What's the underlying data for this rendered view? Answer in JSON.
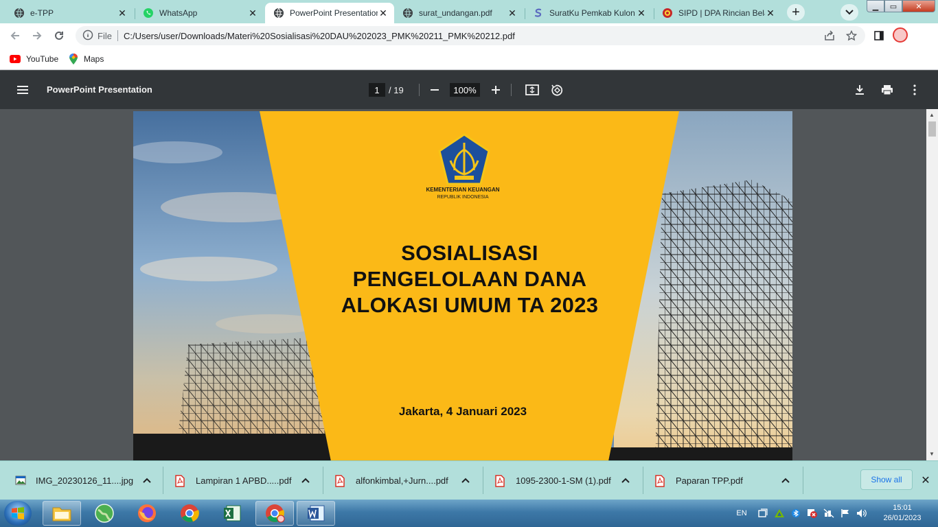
{
  "browser": {
    "tabs": [
      {
        "title": "e-TPP",
        "icon": "globe-icon",
        "active": false
      },
      {
        "title": "WhatsApp",
        "icon": "whatsapp-icon",
        "active": false
      },
      {
        "title": "PowerPoint Presentation",
        "icon": "globe-icon",
        "active": true
      },
      {
        "title": "surat_undangan.pdf",
        "icon": "globe-icon",
        "active": false
      },
      {
        "title": "SuratKu Pemkab Kulon",
        "icon": "suratku-icon",
        "active": false
      },
      {
        "title": "SIPD | DPA Rincian Bela",
        "icon": "sipd-icon",
        "active": false
      }
    ],
    "omnibox": {
      "scheme": "File",
      "url": "C:/Users/user/Downloads/Materi%20Sosialisasi%20DAU%202023_PMK%20211_PMK%20212.pdf"
    },
    "bookmarks": [
      {
        "label": "YouTube",
        "icon": "youtube-icon"
      },
      {
        "label": "Maps",
        "icon": "maps-icon"
      }
    ]
  },
  "pdf": {
    "title": "PowerPoint Presentation",
    "current_page": "1",
    "total_pages": "/ 19",
    "zoom": "100%"
  },
  "slide": {
    "org_line1": "KEMENTERIAN KEUANGAN",
    "org_line2": "REPUBLIK INDONESIA",
    "title_line1": "SOSIALISASI",
    "title_line2": "PENGELOLAAN DANA",
    "title_line3": "ALOKASI UMUM TA 2023",
    "date": "Jakarta, 4 Januari 2023"
  },
  "downloads": {
    "items": [
      {
        "name": "IMG_20230126_11....jpg",
        "type": "image"
      },
      {
        "name": "Lampiran 1 APBD.....pdf",
        "type": "pdf"
      },
      {
        "name": "alfonkimbal,+Jurn....pdf",
        "type": "pdf"
      },
      {
        "name": "1095-2300-1-SM (1).pdf",
        "type": "pdf"
      },
      {
        "name": "Paparan TPP.pdf",
        "type": "pdf"
      }
    ],
    "show_all": "Show all"
  },
  "taskbar": {
    "language": "EN",
    "time": "15:01",
    "date": "26/01/2023"
  },
  "colors": {
    "tabstrip": "#b2dfdb",
    "slide_yellow": "#fbb917",
    "pdf_toolbar": "#323639"
  }
}
